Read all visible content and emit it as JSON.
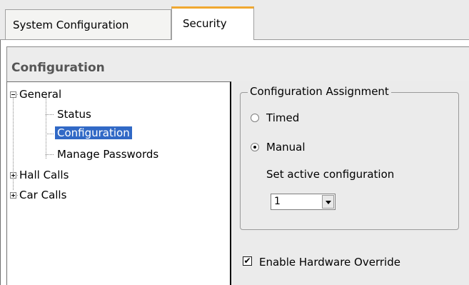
{
  "tabs": [
    {
      "label": "System Configuration",
      "active": false
    },
    {
      "label": "Security",
      "active": true
    }
  ],
  "panel": {
    "title": "Configuration"
  },
  "tree": {
    "general": "General",
    "status": "Status",
    "configuration": "Configuration",
    "manage_passwords": "Manage Passwords",
    "hall_calls": "Hall Calls",
    "car_calls": "Car Calls",
    "selected": "Configuration"
  },
  "config_assignment": {
    "legend": "Configuration Assignment",
    "timed_label": "Timed",
    "manual_label": "Manual",
    "selected_mode": "Manual",
    "set_active_label": "Set active configuration",
    "active_configuration": "1"
  },
  "hardware_override": {
    "label": "Enable Hardware Override",
    "checked": true,
    "check_glyph": "✔"
  },
  "colors": {
    "selection": "#3169c6",
    "active_tab_accent": "#f0a830"
  }
}
